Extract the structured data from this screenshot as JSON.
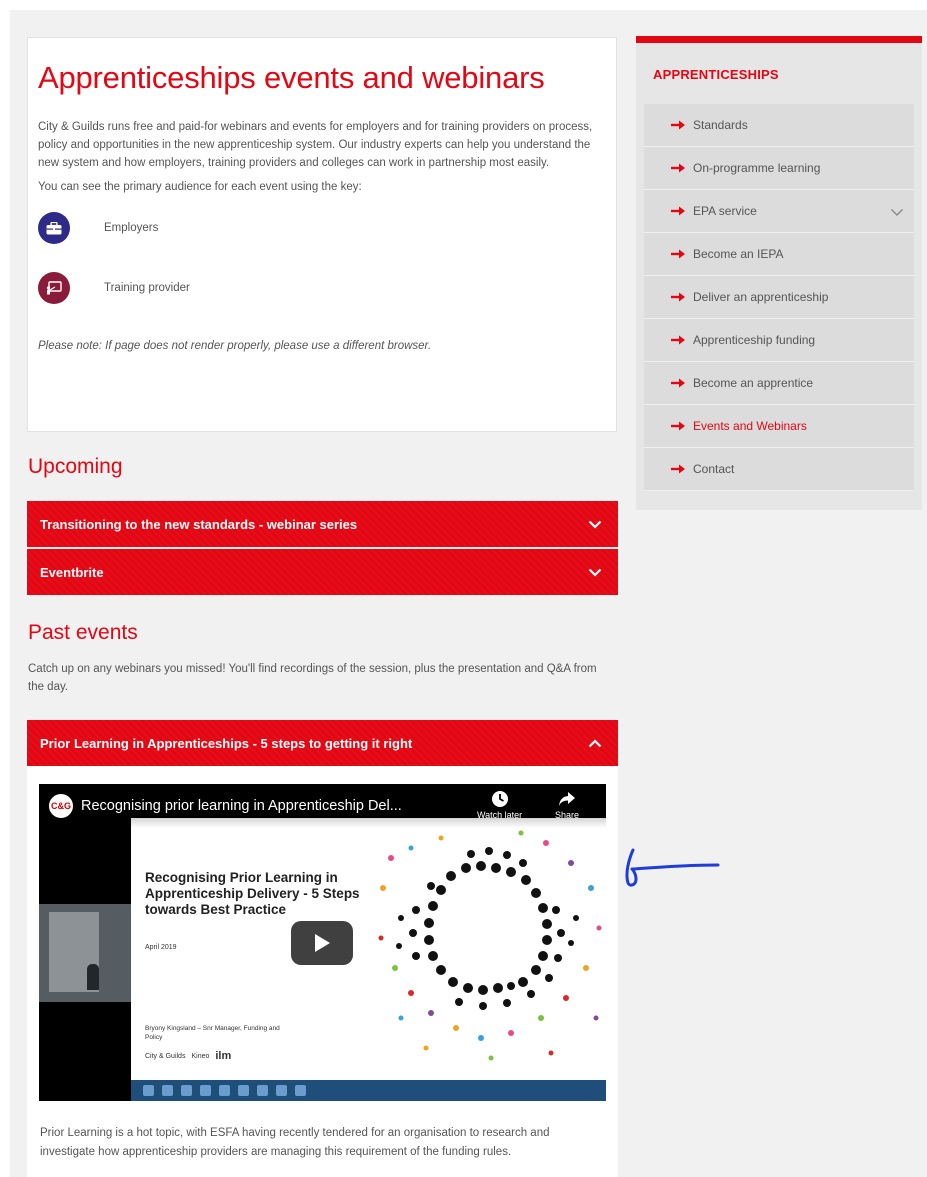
{
  "main": {
    "title": "Apprenticeships events and webinars",
    "intro": "City & Guilds runs free and paid-for webinars and events for employers and for training providers on process, policy and opportunities in the new apprenticeship system. Our industry experts can help you understand the new system and how employers, training providers and colleges can work in partnership most easily.",
    "key_intro": "You can see the primary audience for each event using the key:",
    "key": [
      {
        "label": "Employers",
        "icon": "briefcase-icon",
        "color": "#2e2a87"
      },
      {
        "label": "Training provider",
        "icon": "presentation-icon",
        "color": "#8a1b3a"
      }
    ],
    "note": "Please note: If page does not render properly, please use a different browser.",
    "upcoming_heading": "Upcoming",
    "upcoming": [
      {
        "label": "Transitioning to the new standards - webinar series",
        "state": "collapsed"
      },
      {
        "label": "Eventbrite",
        "state": "collapsed"
      }
    ],
    "past_heading": "Past events",
    "past_description": "Catch up on any webinars you missed! You'll find recordings of the session, plus the presentation and Q&A from the day.",
    "past_events": [
      {
        "label": "Prior Learning in Apprenticeships - 5 steps to getting it right",
        "state": "expanded",
        "video": {
          "title": "Recognising prior learning in Apprenticeship Del...",
          "channel_initials": "C&G",
          "watch_later_label": "Watch later",
          "share_label": "Share",
          "slide_title": "Recognising Prior Learning in Apprenticeship Delivery - 5 Steps towards Best Practice",
          "slide_date": "April 2019",
          "slide_presenter": "Bryony Kingsland – Snr Manager, Funding and Policy",
          "slide_logos": [
            "City & Guilds",
            "Kineo",
            "ilm"
          ]
        },
        "body": "Prior Learning is a hot topic, with ESFA having recently tendered for an organisation to research and investigate how apprenticeship providers are managing this requirement of the funding rules."
      }
    ]
  },
  "sidebar": {
    "heading": "APPRENTICESHIPS",
    "items": [
      {
        "label": "Standards"
      },
      {
        "label": "On-programme learning"
      },
      {
        "label": "EPA service",
        "expandable": true
      },
      {
        "label": "Become an IEPA"
      },
      {
        "label": "Deliver an apprenticeship"
      },
      {
        "label": "Apprenticeship funding"
      },
      {
        "label": "Become an apprentice"
      },
      {
        "label": "Events and Webinars",
        "active": true
      },
      {
        "label": "Contact"
      }
    ]
  },
  "colors": {
    "brand_red": "#e30613",
    "employer": "#2e2a87",
    "provider": "#8a1b3a",
    "annotation_ink": "#1f3dd8"
  }
}
